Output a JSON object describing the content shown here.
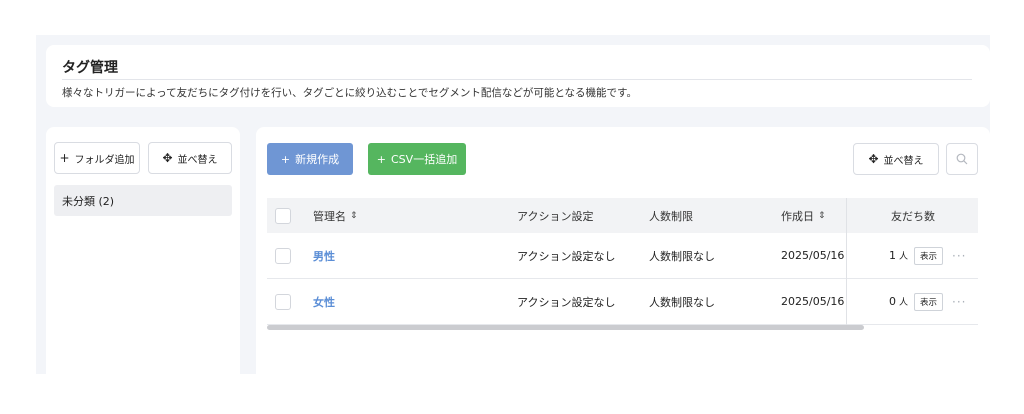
{
  "header": {
    "title": "タグ管理",
    "description": "様々なトリガーによって友だちにタグ付けを行い、タグごとに絞り込むことでセグメント配信などが可能となる機能です。"
  },
  "sidebar": {
    "add_folder_label": "フォルダ追加",
    "sort_label": "並べ替え",
    "folders": [
      {
        "label": "未分類 (2)"
      }
    ]
  },
  "toolbar": {
    "new_label": "新規作成",
    "csv_label": "CSV一括追加",
    "sort_label": "並べ替え",
    "accent_blue": "#6f96d4",
    "accent_green": "#55b65f"
  },
  "table": {
    "headers": {
      "name": "管理名",
      "action": "アクション設定",
      "limit": "人数制限",
      "created": "作成日",
      "friends": "友だち数"
    },
    "rows": [
      {
        "name": "男性",
        "action": "アクション設定なし",
        "limit": "人数制限なし",
        "created": "2025/05/16",
        "count": "1",
        "unit": "人",
        "view_label": "表示"
      },
      {
        "name": "女性",
        "action": "アクション設定なし",
        "limit": "人数制限なし",
        "created": "2025/05/16",
        "count": "0",
        "unit": "人",
        "view_label": "表示"
      }
    ],
    "link_color": "#5b8ed6"
  }
}
